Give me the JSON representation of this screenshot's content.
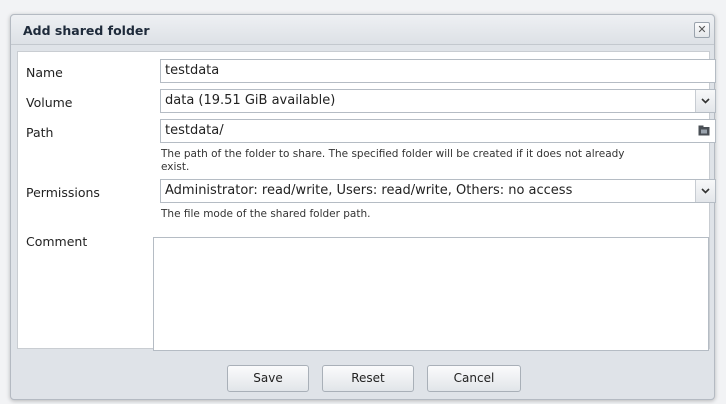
{
  "dialog": {
    "title": "Add shared folder",
    "close_symbol": "✕"
  },
  "form": {
    "name": {
      "label": "Name",
      "value": "testdata"
    },
    "volume": {
      "label": "Volume",
      "value": "data (19.51 GiB available)",
      "dropdown_icon": "chevron-down-icon"
    },
    "path": {
      "label": "Path",
      "value": "testdata/",
      "browse_icon": "folder-icon",
      "help_line1": "The path of the folder to share. The specified folder will be created if it does not already",
      "help_line2": "exist."
    },
    "permissions": {
      "label": "Permissions",
      "value": "Administrator: read/write, Users: read/write, Others: no access",
      "dropdown_icon": "chevron-down-icon",
      "help": "The file mode of the shared folder path."
    },
    "comment": {
      "label": "Comment",
      "value": ""
    }
  },
  "buttons": {
    "save": "Save",
    "reset": "Reset",
    "cancel": "Cancel"
  }
}
